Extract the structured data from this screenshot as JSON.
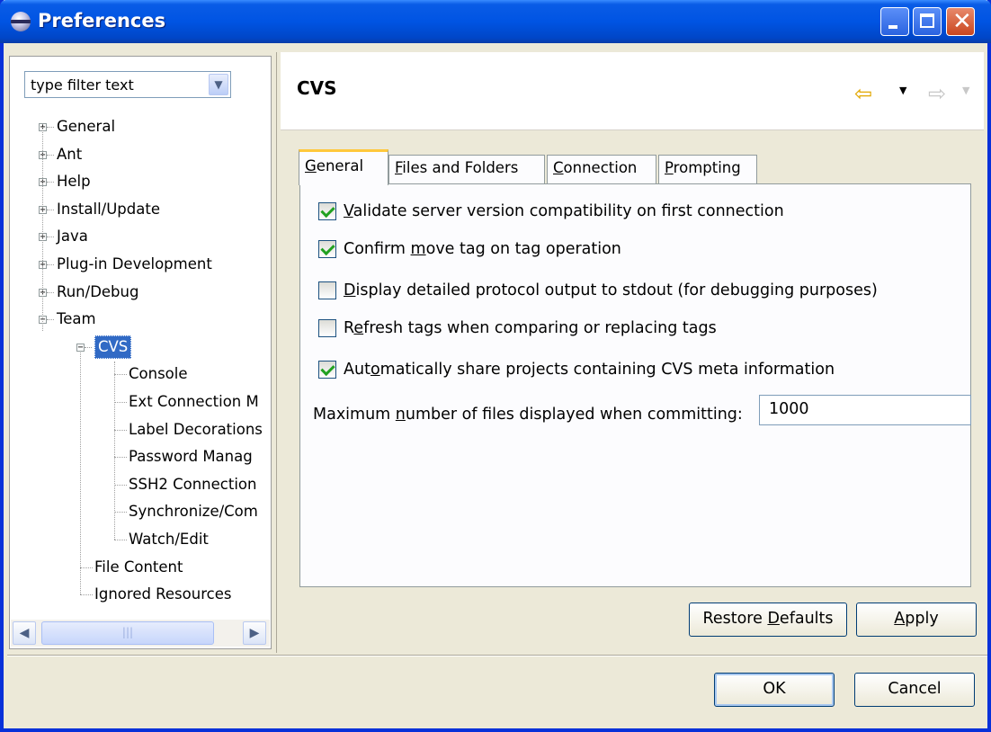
{
  "window": {
    "title": "Preferences",
    "controls": {
      "minimize": "minimize",
      "maximize": "maximize",
      "close": "close"
    }
  },
  "filter": {
    "value": "type filter text"
  },
  "tree": {
    "items": [
      {
        "label": "General",
        "level": 0,
        "expander": "+"
      },
      {
        "label": "Ant",
        "level": 0,
        "expander": "+"
      },
      {
        "label": "Help",
        "level": 0,
        "expander": "+"
      },
      {
        "label": "Install/Update",
        "level": 0,
        "expander": "+"
      },
      {
        "label": "Java",
        "level": 0,
        "expander": "+"
      },
      {
        "label": "Plug-in Development",
        "level": 0,
        "expander": "+"
      },
      {
        "label": "Run/Debug",
        "level": 0,
        "expander": "+"
      },
      {
        "label": "Team",
        "level": 0,
        "expander": "-"
      },
      {
        "label": "CVS",
        "level": 1,
        "expander": "-",
        "selected": true
      },
      {
        "label": "Console",
        "level": 2
      },
      {
        "label": "Ext Connection M",
        "level": 2
      },
      {
        "label": "Label Decorations",
        "level": 2
      },
      {
        "label": "Password Manag",
        "level": 2
      },
      {
        "label": "SSH2 Connection",
        "level": 2
      },
      {
        "label": "Synchronize/Com",
        "level": 2
      },
      {
        "label": "Watch/Edit",
        "level": 2
      },
      {
        "label": "File Content",
        "level": 1
      },
      {
        "label": "Ignored Resources",
        "level": 1
      }
    ]
  },
  "page": {
    "title": "CVS",
    "nav": {
      "back_icon": "back-arrow-icon",
      "forward_icon": "forward-arrow-icon"
    }
  },
  "tabs": [
    {
      "label": "General",
      "mnemonic_index": 0,
      "active": true
    },
    {
      "label": "Files and Folders",
      "mnemonic_index": 0
    },
    {
      "label": "Connection",
      "mnemonic_index": 0
    },
    {
      "label": "Prompting",
      "mnemonic_index": 0
    }
  ],
  "options": [
    {
      "pre": "",
      "key": "V",
      "post": "alidate server version compatibility on first connection",
      "checked": true
    },
    {
      "pre": "Confirm ",
      "key": "m",
      "post": "ove tag on tag operation",
      "checked": true
    },
    {
      "pre": "",
      "key": "D",
      "post": "isplay detailed protocol output to stdout (for debugging purposes)",
      "checked": false
    },
    {
      "pre": "R",
      "key": "e",
      "post": "fresh tags when comparing or replacing tags",
      "checked": false
    },
    {
      "pre": "Aut",
      "key": "o",
      "post": "matically share projects containing CVS meta information",
      "checked": true
    }
  ],
  "max_files": {
    "pre": "Maximum ",
    "key": "n",
    "post": "umber of files displayed when committing:",
    "value": "1000"
  },
  "buttons": {
    "restore_pre": "Restore ",
    "restore_key": "D",
    "restore_post": "efaults",
    "apply_key": "A",
    "apply_post": "pply",
    "ok": "OK",
    "cancel": "Cancel"
  },
  "colors": {
    "title_bar": "#0054E3",
    "dialog_bg": "#ECE9D8",
    "selection": "#316AC5",
    "active_tab_accent": "#FFC83C",
    "back_arrow": "#E2A700"
  }
}
